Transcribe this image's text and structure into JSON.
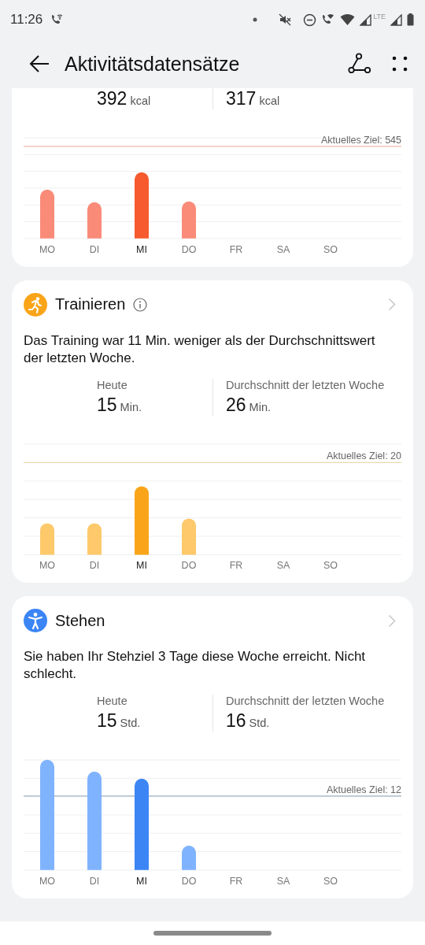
{
  "status_bar": {
    "time": "11:26",
    "network": "LTE"
  },
  "header": {
    "title": "Aktivitätsdatensätze"
  },
  "cards": [
    {
      "kind": "calories",
      "stats": [
        {
          "value": "392",
          "unit": "kcal"
        },
        {
          "value": "317",
          "unit": "kcal"
        }
      ],
      "goal_label": "Aktuelles Ziel: 545",
      "days": [
        {
          "label": "MO",
          "selected": false
        },
        {
          "label": "DI",
          "selected": false
        },
        {
          "label": "MI",
          "selected": true
        },
        {
          "label": "DO",
          "selected": false
        },
        {
          "label": "FR",
          "selected": false
        },
        {
          "label": "SA",
          "selected": false
        },
        {
          "label": "SO",
          "selected": false
        }
      ]
    },
    {
      "kind": "exercise",
      "title": "Trainieren",
      "info": true,
      "message": "Das Training war 11 Min. weniger als der Durchschnittswert der letzten Woche.",
      "stats": [
        {
          "label": "Heute",
          "value": "15",
          "unit": "Min."
        },
        {
          "label": "Durchschnitt der letzten Woche",
          "value": "26",
          "unit": "Min."
        }
      ],
      "goal_label": "Aktuelles Ziel: 20",
      "days": [
        {
          "label": "MO",
          "selected": false
        },
        {
          "label": "DI",
          "selected": false
        },
        {
          "label": "MI",
          "selected": true
        },
        {
          "label": "DO",
          "selected": false
        },
        {
          "label": "FR",
          "selected": false
        },
        {
          "label": "SA",
          "selected": false
        },
        {
          "label": "SO",
          "selected": false
        }
      ]
    },
    {
      "kind": "stand",
      "title": "Stehen",
      "info": false,
      "message": "Sie haben Ihr Stehziel 3 Tage diese Woche erreicht. Nicht schlecht.",
      "stats": [
        {
          "label": "Heute",
          "value": "15",
          "unit": "Std."
        },
        {
          "label": "Durchschnitt der letzten Woche",
          "value": "16",
          "unit": "Std."
        }
      ],
      "goal_label": "Aktuelles Ziel: 12",
      "days": [
        {
          "label": "MO",
          "selected": false
        },
        {
          "label": "DI",
          "selected": false
        },
        {
          "label": "MI",
          "selected": true
        },
        {
          "label": "DO",
          "selected": false
        },
        {
          "label": "FR",
          "selected": false
        },
        {
          "label": "SA",
          "selected": false
        },
        {
          "label": "SO",
          "selected": false
        }
      ]
    }
  ]
}
